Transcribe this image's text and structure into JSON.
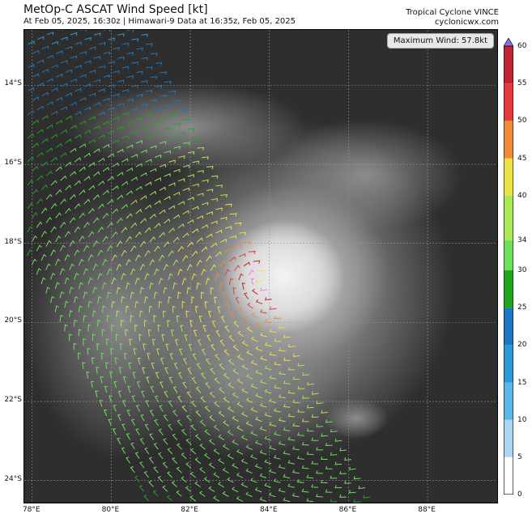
{
  "header": {
    "title": "MetOp-C ASCAT Wind Speed [kt]",
    "subtitle": "At Feb 05, 2025, 16:30z | Himawari-9 Data at 16:35z, Feb 05, 2025",
    "storm": "Tropical Cyclone VINCE",
    "site": "cyclonicwx.com"
  },
  "map": {
    "max_wind_label": "Maximum Wind: 57.8kt",
    "lat_labels": [
      "14°S",
      "16°S",
      "18°S",
      "20°S",
      "22°S",
      "24°S"
    ],
    "lon_labels": [
      "78°E",
      "80°E",
      "82°E",
      "84°E",
      "86°E",
      "88°E"
    ],
    "storm_center": {
      "lon": 83.8,
      "lat": -18.9
    },
    "lon_range": [
      77.8,
      89.8
    ],
    "lat_range": [
      -24.6,
      -12.6
    ]
  },
  "colorbar": {
    "ticks": [
      "60",
      "55",
      "50",
      "45",
      "40",
      "34",
      "30",
      "25",
      "20",
      "15",
      "10",
      "5",
      "0"
    ],
    "bounds": [
      0,
      5,
      10,
      15,
      20,
      25,
      30,
      34,
      40,
      45,
      50,
      55,
      60
    ],
    "colors": [
      "#ffffff",
      "#a9d7f2",
      "#5ab7e8",
      "#2c98d6",
      "#1f78c0",
      "#22a51f",
      "#6fe05d",
      "#a9e856",
      "#ebe046",
      "#ef8a3b",
      "#e53a3d",
      "#c22531",
      "#f57be8",
      "#8a3fbe",
      "#8b6ed6"
    ]
  }
}
